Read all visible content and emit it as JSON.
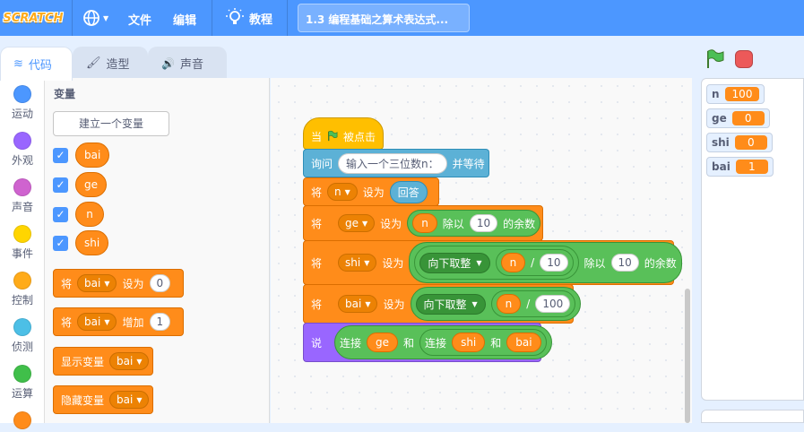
{
  "menu": {
    "logo": "SCRATCH",
    "file": "文件",
    "edit": "编辑",
    "tutorials": "教程",
    "project_title": "1.3 编程基础之算术表达式..."
  },
  "tabs": {
    "code": "代码",
    "costumes": "造型",
    "sounds": "声音"
  },
  "categories": [
    {
      "label": "运动",
      "color": "#4c97ff"
    },
    {
      "label": "外观",
      "color": "#9966ff"
    },
    {
      "label": "声音",
      "color": "#cf63cf"
    },
    {
      "label": "事件",
      "color": "#ffd500"
    },
    {
      "label": "控制",
      "color": "#ffab19"
    },
    {
      "label": "侦测",
      "color": "#4cbfe6"
    },
    {
      "label": "运算",
      "color": "#40bf4a"
    }
  ],
  "palette": {
    "title": "变量",
    "make_variable": "建立一个变量",
    "variables": [
      "bai",
      "ge",
      "n",
      "shi"
    ],
    "set_block": {
      "label": "将",
      "var": "bai",
      "action": "设为",
      "value": "0"
    },
    "change_block": {
      "label": "将",
      "var": "bai",
      "action": "增加",
      "value": "1"
    },
    "show_block": {
      "label": "显示变量",
      "var": "bai"
    },
    "hide_block": {
      "label": "隐藏变量",
      "var": "bai"
    }
  },
  "script": {
    "hat": {
      "label": "当",
      "suffix": "被点击"
    },
    "ask": {
      "label": "询问",
      "prompt": "输入一个三位数n：",
      "suffix": "并等待"
    },
    "set_n": {
      "label": "将",
      "var": "n",
      "action": "设为",
      "value": "回答"
    },
    "set_ge": {
      "label": "将",
      "var": "ge",
      "action": "设为",
      "op_var": "n",
      "op": "除以",
      "num": "10",
      "suffix": "的余数"
    },
    "set_shi": {
      "label": "将",
      "var": "shi",
      "action": "设为",
      "floor": "向下取整",
      "op_var": "n",
      "div": "/",
      "num1": "10",
      "op": "除以",
      "num2": "10",
      "suffix": "的余数"
    },
    "set_bai": {
      "label": "将",
      "var": "bai",
      "action": "设为",
      "floor": "向下取整",
      "op_var": "n",
      "div": "/",
      "num": "100"
    },
    "say": {
      "label": "说",
      "join1": "连接",
      "v1": "ge",
      "and1": "和",
      "join2": "连接",
      "v2": "shi",
      "and2": "和",
      "v3": "bai"
    }
  },
  "monitors": [
    {
      "name": "n",
      "value": "100"
    },
    {
      "name": "ge",
      "value": "0"
    },
    {
      "name": "shi",
      "value": "0"
    },
    {
      "name": "bai",
      "value": "1"
    }
  ],
  "colors": {
    "menubar": "#4c97ff",
    "variables": "#ff8c1a",
    "operators": "#59c059",
    "events": "#ffbf00",
    "sensing": "#5cb1d6",
    "looks": "#9966ff"
  }
}
